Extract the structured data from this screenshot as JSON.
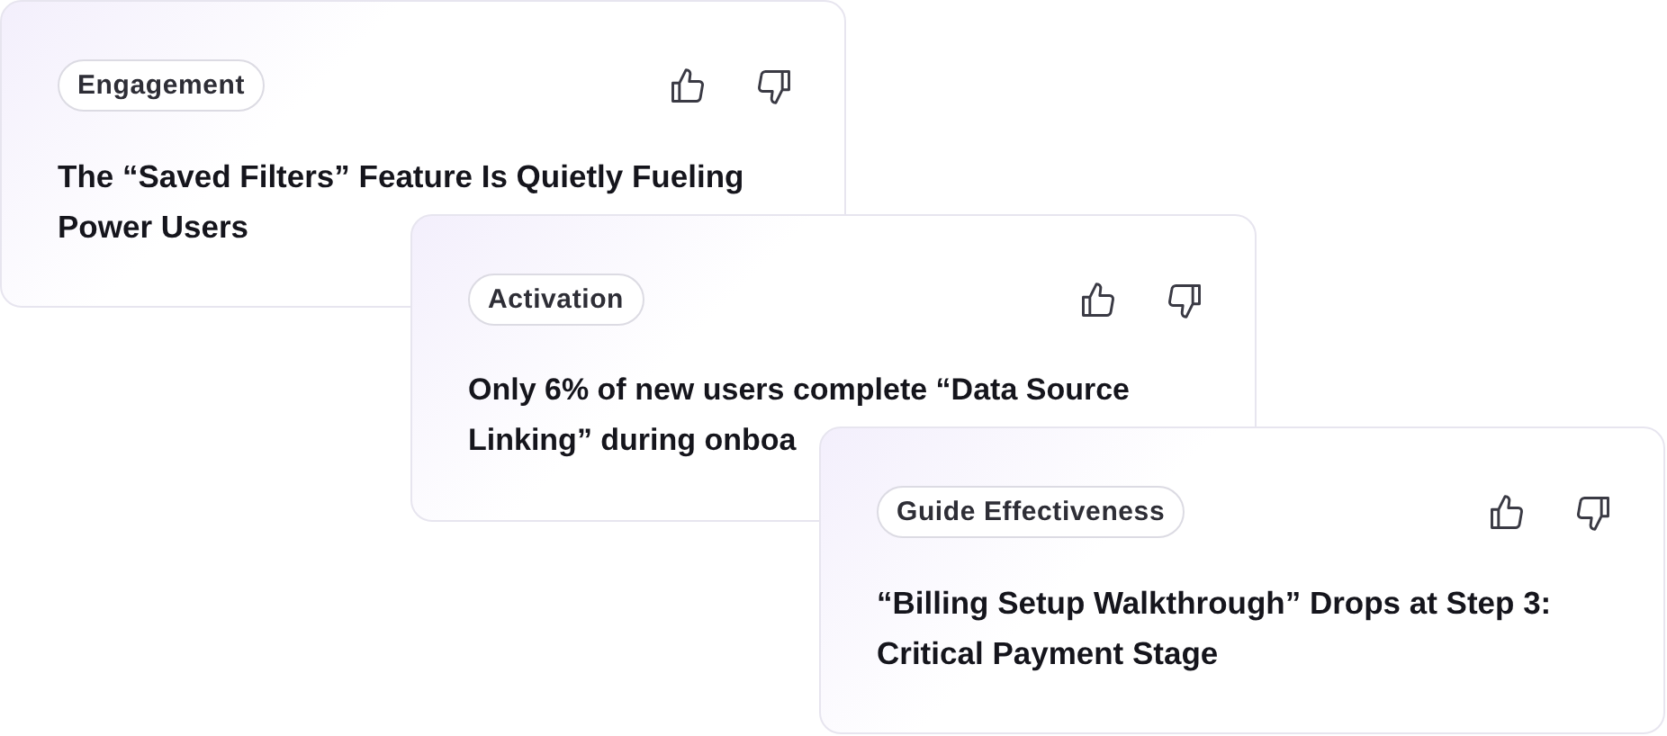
{
  "cards": [
    {
      "tag": "Engagement",
      "title": "The “Saved Filters” Feature Is Quietly Fueling Power Users"
    },
    {
      "tag": "Activation",
      "title": "Only 6% of new users complete “Data Source Linking” during onboa"
    },
    {
      "tag": "Guide Effectiveness",
      "title": "“Billing Setup Walkthrough” Drops at Step 3: Critical Payment Stage"
    }
  ]
}
